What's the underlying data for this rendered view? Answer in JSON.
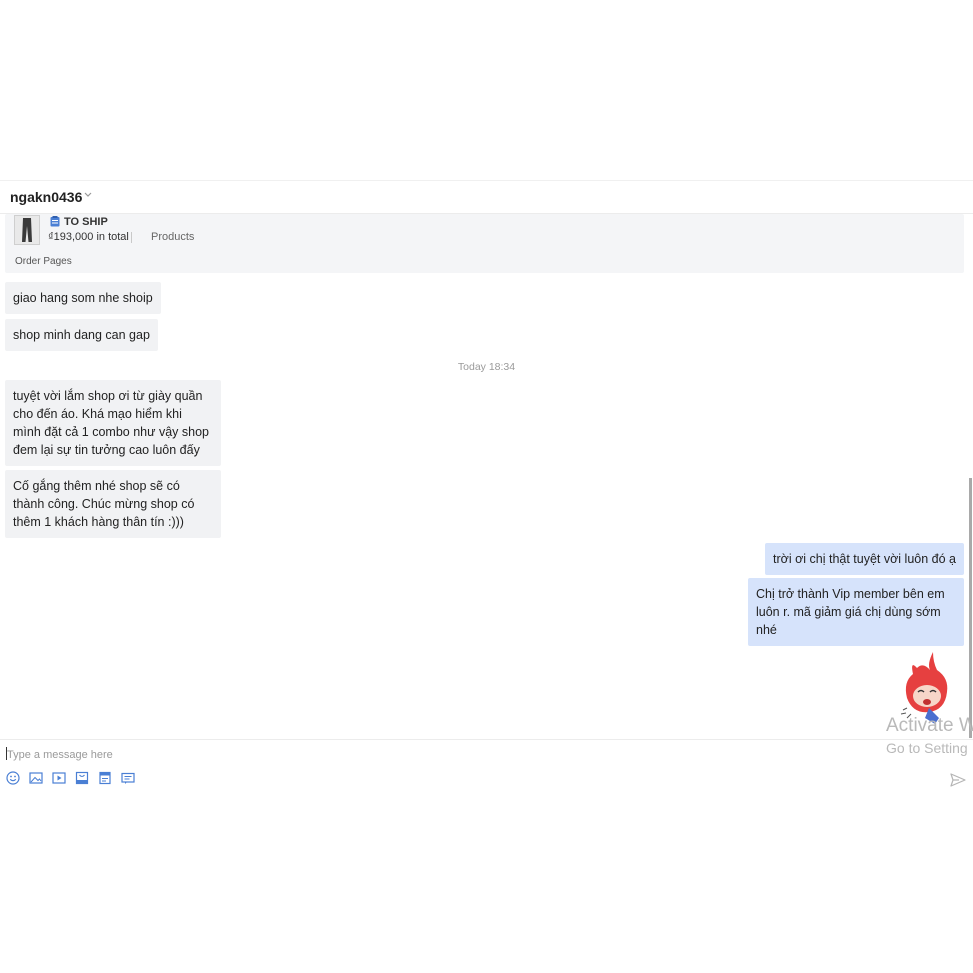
{
  "header": {
    "username": "ngakn0436"
  },
  "order": {
    "status": "TO SHIP",
    "total": "₫193,000 in total",
    "products_link": "Products",
    "order_link": "Order Pages"
  },
  "messages_before": [
    {
      "text": "giao hang som nhe shoip"
    },
    {
      "text": "shop minh dang can gap"
    }
  ],
  "timestamp": "Today 18:34",
  "messages_after_in": [
    {
      "text": "tuyệt vời lắm shop ơi từ giày quần cho đến áo. Khá mạo hiểm khi mình đặt cả 1 combo như vậy shop đem lại sự tin tưởng cao luôn đấy"
    },
    {
      "text": "Cố gắng thêm nhé shop sẽ có thành công. Chúc mừng shop có thêm 1 khách hàng thân tín :)))"
    }
  ],
  "messages_out": [
    {
      "text": "trời ơi chị thật tuyệt vời luôn đó ạ"
    },
    {
      "text": "Chị trở thành Vip member bên em luôn r. mã giảm giá chị dùng sớm nhé"
    }
  ],
  "watermark": {
    "line1": "Activate W",
    "line2": "Go to Setting"
  },
  "composer": {
    "placeholder": "Type a message here",
    "tools": [
      "emoji-icon",
      "image-icon",
      "video-icon",
      "product-icon",
      "order-icon",
      "voucher-icon"
    ],
    "send_icon": "send-icon"
  },
  "colors": {
    "incoming_bubble": "#f1f2f4",
    "outgoing_bubble": "#d6e3fb",
    "accent": "#4a7fd4"
  }
}
